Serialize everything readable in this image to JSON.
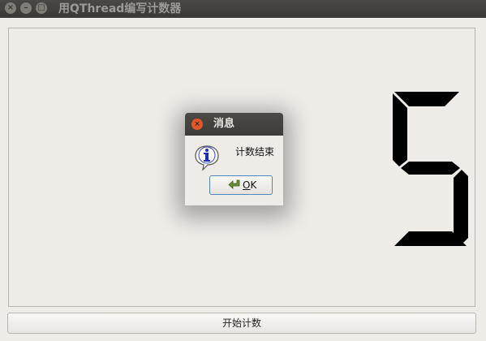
{
  "window": {
    "title": "用QThread编写计数器",
    "controls": {
      "close": "×",
      "minimize": "–",
      "maximize": "□"
    }
  },
  "lcd": {
    "value": "5",
    "digit_color": "#000000"
  },
  "start_button": {
    "label": "开始计数"
  },
  "dialog": {
    "title": "消息",
    "message": "计数结束",
    "close_glyph": "×",
    "icon": "information-icon",
    "ok_button": {
      "mnemonic": "O",
      "rest": "K"
    }
  },
  "colors": {
    "window_bg": "#efebe7",
    "titlebar": "#3c3b37",
    "close_accent": "#e0572a",
    "focus_border": "#4f86c1"
  }
}
